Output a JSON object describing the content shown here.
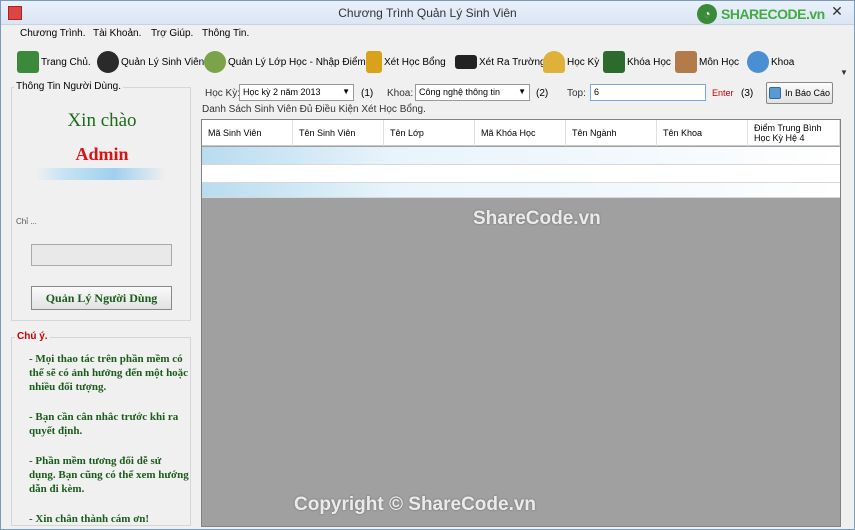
{
  "window": {
    "title": "Chương Trình Quản Lý Sinh Viên",
    "close_glyph": "✕",
    "brand_text": "SHARECODE.vn"
  },
  "menu": [
    {
      "label": "Chương Trình."
    },
    {
      "label": "Tài Khoản."
    },
    {
      "label": "Trợ Giúp."
    },
    {
      "label": "Thông Tin."
    }
  ],
  "toolbar": [
    {
      "label": "Trang Chủ.",
      "icon": "home-icon",
      "color": "#3b8a3b"
    },
    {
      "label": "Quản Lý Sinh Viên.",
      "icon": "graduate-icon",
      "color": "#2a2a2a"
    },
    {
      "label": "Quản Lý Lớp Học - Nhập Điểm.",
      "icon": "people-icon",
      "color": "#7aa34a"
    },
    {
      "label": "Xét Học Bổng",
      "icon": "trophy-icon",
      "color": "#d9a21a"
    },
    {
      "label": "Xét Ra Trường",
      "icon": "grad-cap-icon",
      "color": "#222222"
    },
    {
      "label": "Học Kỳ",
      "icon": "bell-icon",
      "color": "#e0b13a"
    },
    {
      "label": "Khóa Học",
      "icon": "blackboard-icon",
      "color": "#2d6b2d"
    },
    {
      "label": "Môn Học",
      "icon": "books-icon",
      "color": "#b37a4a"
    },
    {
      "label": "Khoa",
      "icon": "atom-icon",
      "color": "#4a8fd4"
    }
  ],
  "left_panel": {
    "group_title": "Thông Tin Người Dùng.",
    "welcome": "Xin chào",
    "username": "Admin",
    "info_line": "Chỉ ...",
    "manage_button": "Quản Lý Người Dùng",
    "note_title": "Chú ý.",
    "notes": [
      "- Mọi thao tác trên phần mềm có thể sẽ có ảnh hưởng đến một hoặc nhiều đối tượng.",
      "- Bạn cần cân nhắc trước khi ra quyết định.",
      "- Phần mềm tương đối dễ sử dụng. Bạn cũng có thể xem hướng dẫn đi kèm.",
      "- Xin chân thành cám ơn!"
    ]
  },
  "filters": {
    "semester_label": "Học Kỳ:",
    "semester_value": "Học kỳ 2 năm 2013",
    "semester_num": "(1)",
    "faculty_label": "Khoa:",
    "faculty_value": "Công nghệ thông tin",
    "faculty_num": "(2)",
    "top_label": "Top:",
    "top_value": "6",
    "enter_label": "Enter",
    "top_num": "(3)",
    "report_button": "In Báo Cáo"
  },
  "grid": {
    "title": "Danh Sách Sinh Viên Đủ Điều Kiện Xét Học Bổng.",
    "columns": [
      "Mã Sinh Viên",
      "Tên Sinh Viên",
      "Tên Lớp",
      "Mã Khóa Học",
      "Tên Ngành",
      "Tên Khoa",
      "Điểm Trung Bình Học Kỳ Hệ 4"
    ]
  },
  "watermarks": {
    "center": "ShareCode.vn",
    "bottom": "Copyright © ShareCode.vn"
  },
  "colors": {
    "welcome": "#1a6b1a",
    "username": "#dd1111",
    "note_text": "#1a5c1a",
    "note_title": "#cc0000",
    "grid_background": "#a0a0a0"
  }
}
